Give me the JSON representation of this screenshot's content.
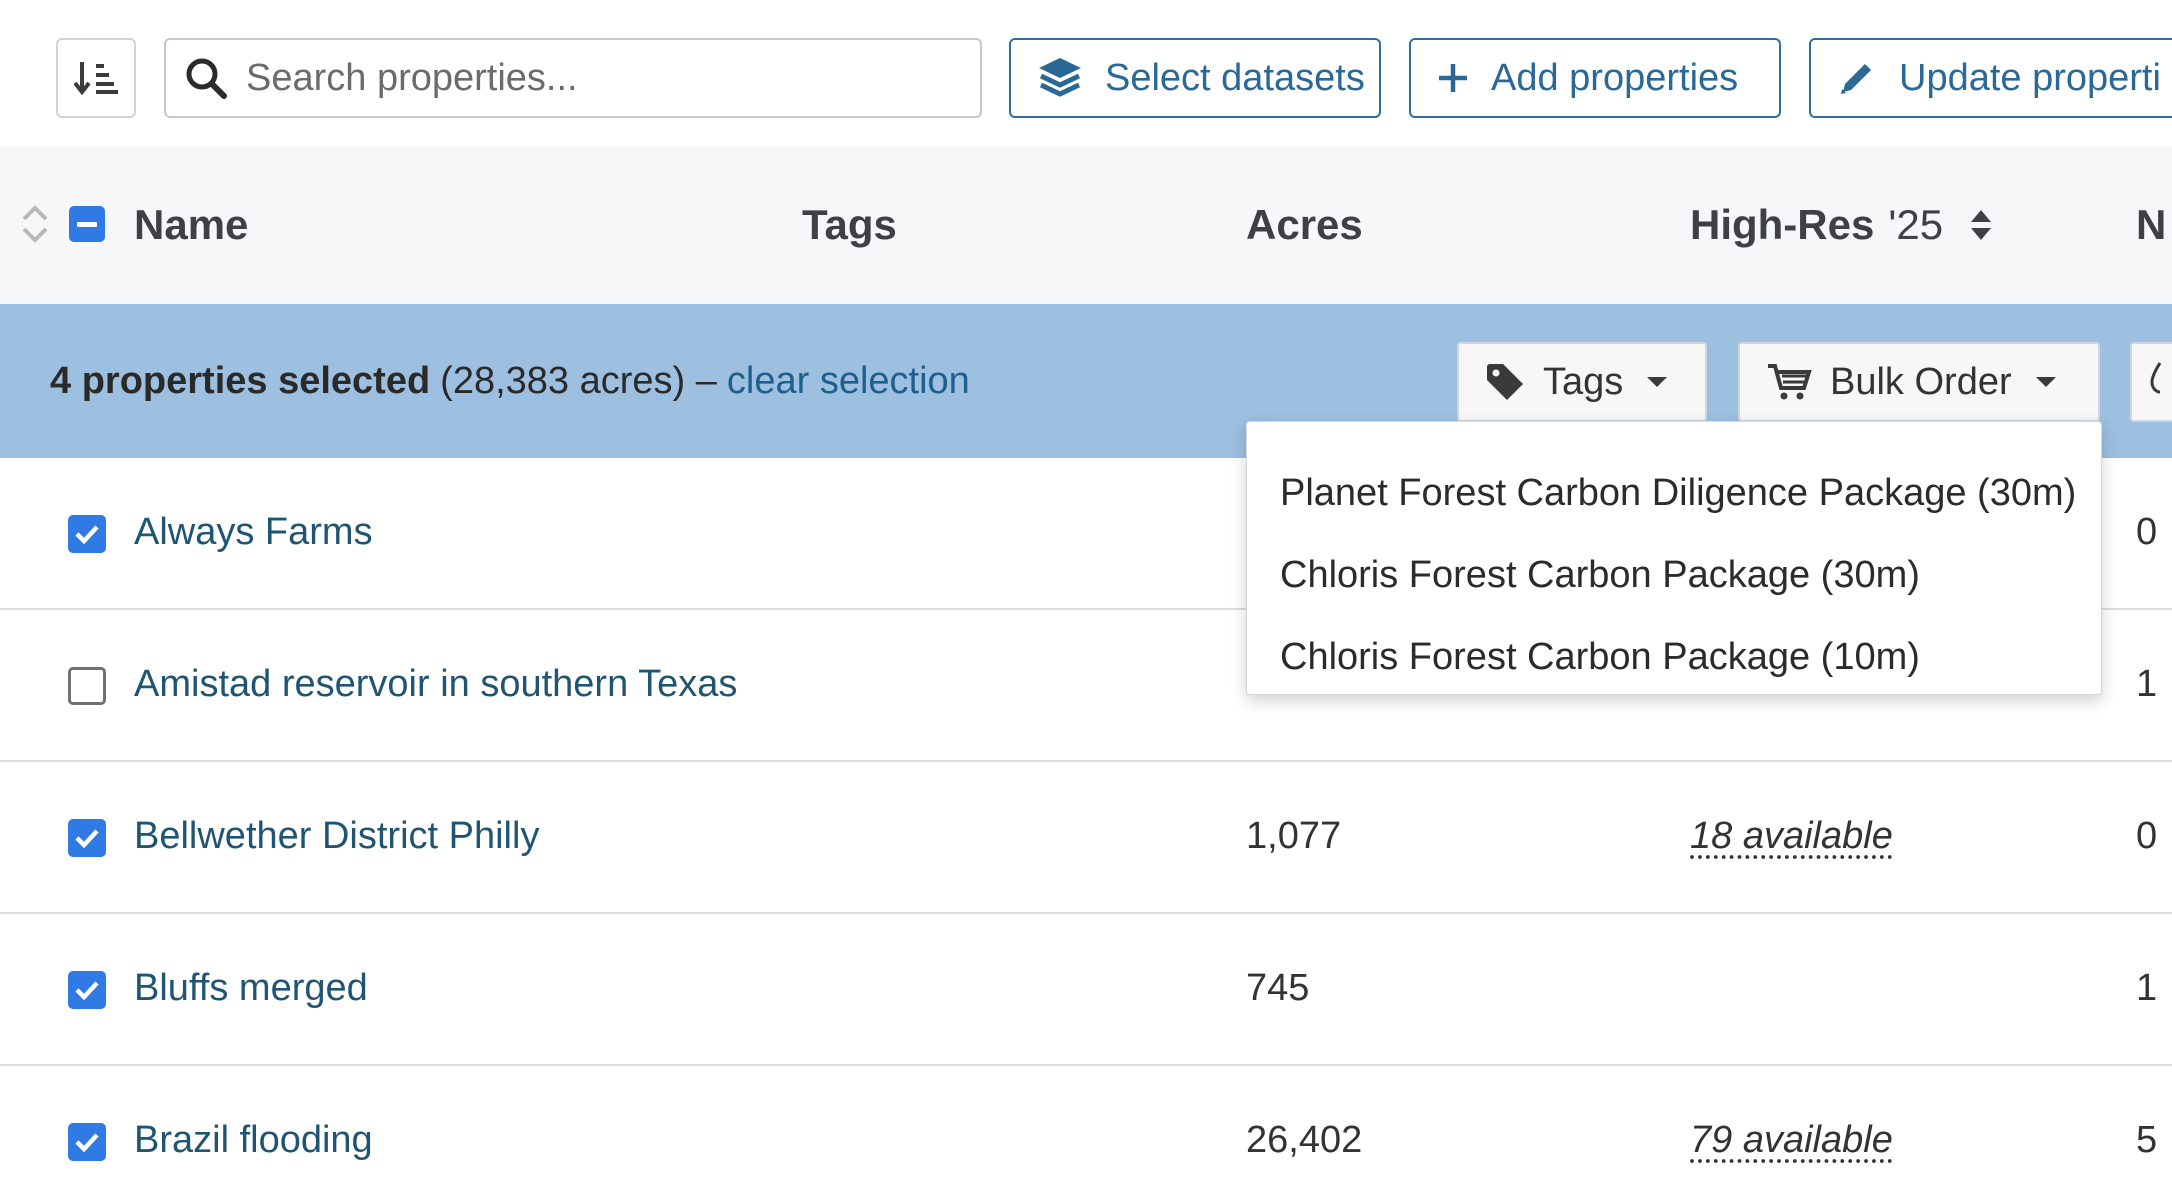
{
  "toolbar": {
    "search_placeholder": "Search properties...",
    "select_datasets_label": "Select datasets",
    "add_properties_label": "Add properties",
    "update_properties_label": "Update properti"
  },
  "table_header": {
    "name": "Name",
    "tags": "Tags",
    "acres": "Acres",
    "high_res": "High-Res",
    "high_res_year": "'25",
    "next_col": "N"
  },
  "selection": {
    "count_label": "4 properties selected",
    "acres_label": "(28,383 acres) –",
    "clear_label": "clear selection",
    "tags_button": "Tags",
    "bulk_order_button": "Bulk Order"
  },
  "bulk_order_menu": [
    "Planet Forest Carbon Diligence Package (30m)",
    "Chloris Forest Carbon Package (30m)",
    "Chloris Forest Carbon Package (10m)"
  ],
  "rows": [
    {
      "name": "Always Farms",
      "checked": true,
      "acres": "",
      "high_res": "",
      "last": "0"
    },
    {
      "name": "Amistad reservoir in southern Texas",
      "checked": false,
      "acres": "",
      "high_res": "",
      "last": "1"
    },
    {
      "name": "Bellwether District Philly",
      "checked": true,
      "acres": "1,077",
      "high_res": "18 available",
      "last": "0"
    },
    {
      "name": "Bluffs merged",
      "checked": true,
      "acres": "745",
      "high_res": "",
      "last": "1"
    },
    {
      "name": "Brazil flooding",
      "checked": true,
      "acres": "26,402",
      "high_res": "79 available",
      "last": "5"
    }
  ],
  "colors": {
    "accent": "#2f7ae5",
    "link": "#1f5573",
    "selection_bar": "#9dbfe0",
    "button_border": "#2f6f9e"
  }
}
